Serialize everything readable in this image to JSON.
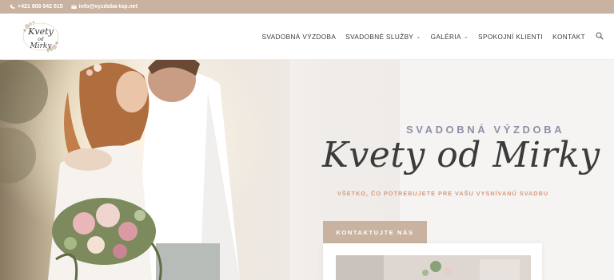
{
  "topbar": {
    "phone": "+421 908 942 515",
    "email": "info@vyzdoba-top.net"
  },
  "logo": {
    "line1": "Kvety",
    "line2": "od",
    "line3": "Mirky"
  },
  "nav": {
    "items": [
      {
        "label": "SVADOBNÁ VÝZDOBA",
        "has_dropdown": false
      },
      {
        "label": "SVADOBNÉ SLUŽBY",
        "has_dropdown": true
      },
      {
        "label": "GALÉRIA",
        "has_dropdown": true
      },
      {
        "label": "SPOKOJNÍ KLIENTI",
        "has_dropdown": false
      },
      {
        "label": "KONTAKT",
        "has_dropdown": false
      }
    ],
    "search_icon": "search-icon"
  },
  "hero": {
    "subtitle": "SVADOBNÁ VÝZDOBA",
    "brand": "Kvety od Mirky",
    "tagline": "VŠETKO, ČO POTREBUJETE PRE VAŠU VYSNÍVANÚ SVADBU",
    "cta_label": "KONTAKTUJTE NÁS"
  },
  "colors": {
    "accent": "#c9b3a0",
    "subtitle": "#8e8fa7",
    "tagline": "#d59a7b",
    "text": "#3a3a3a"
  }
}
